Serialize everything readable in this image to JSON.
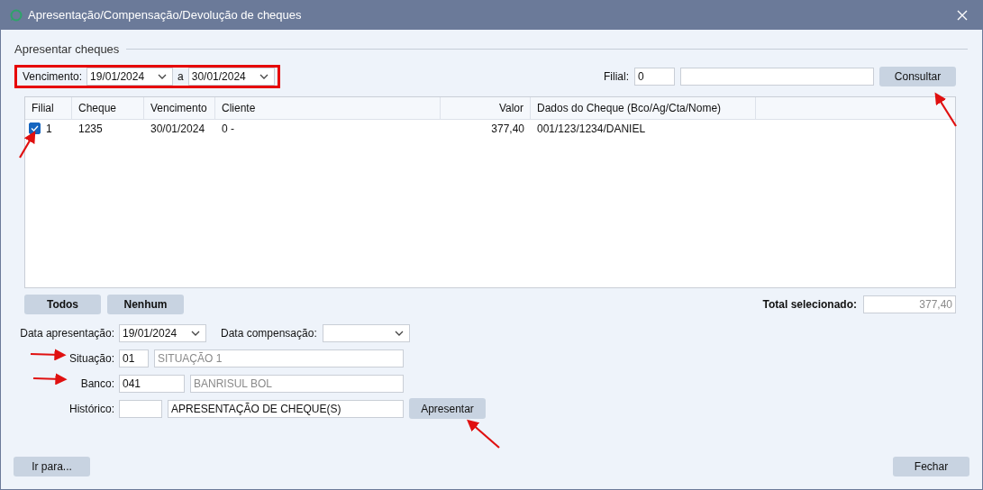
{
  "window": {
    "title": "Apresentação/Compensação/Devolução de cheques"
  },
  "group": {
    "title": "Apresentar cheques"
  },
  "filter": {
    "label": "Vencimento:",
    "from": "19/01/2024",
    "separator": "a",
    "to": "30/01/2024"
  },
  "filial": {
    "label": "Filial:",
    "code": "0"
  },
  "consult_button": "Consultar",
  "table": {
    "columns": [
      {
        "label": "Filial",
        "kind": "text"
      },
      {
        "label": "Cheque",
        "kind": "text"
      },
      {
        "label": "Vencimento",
        "kind": "text"
      },
      {
        "label": "Cliente",
        "kind": "text"
      },
      {
        "label": "Valor",
        "kind": "number"
      },
      {
        "label": "Dados do Cheque (Bco/Ag/Cta/Nome)",
        "kind": "text"
      }
    ],
    "rows": [
      {
        "checked": true,
        "cells": [
          "1",
          "1235",
          "30/01/2024",
          "0 -",
          "377,40",
          "001/123/1234/DANIEL"
        ]
      }
    ]
  },
  "select_buttons": [
    "Todos",
    "Nenhum"
  ],
  "total": {
    "label": "Total selecionado:",
    "value": "377,40"
  },
  "form": {
    "date_presentation": {
      "label": "Data apresentação:",
      "value": "19/01/2024"
    },
    "date_compensation": {
      "label": "Data compensação:"
    },
    "lookups": [
      {
        "label": "Situação:",
        "code": "01",
        "description": "SITUAÇÃO 1",
        "disabled": true
      },
      {
        "label": "Banco:",
        "code": "041",
        "description": "BANRISUL BOL",
        "disabled": true
      },
      {
        "label": "Histórico:",
        "description": "APRESENTAÇÃO DE CHEQUE(S)",
        "disabled": false
      }
    ],
    "submit_button": "Apresentar"
  },
  "goto_button": "Ir para...",
  "close_button": "Fechar"
}
